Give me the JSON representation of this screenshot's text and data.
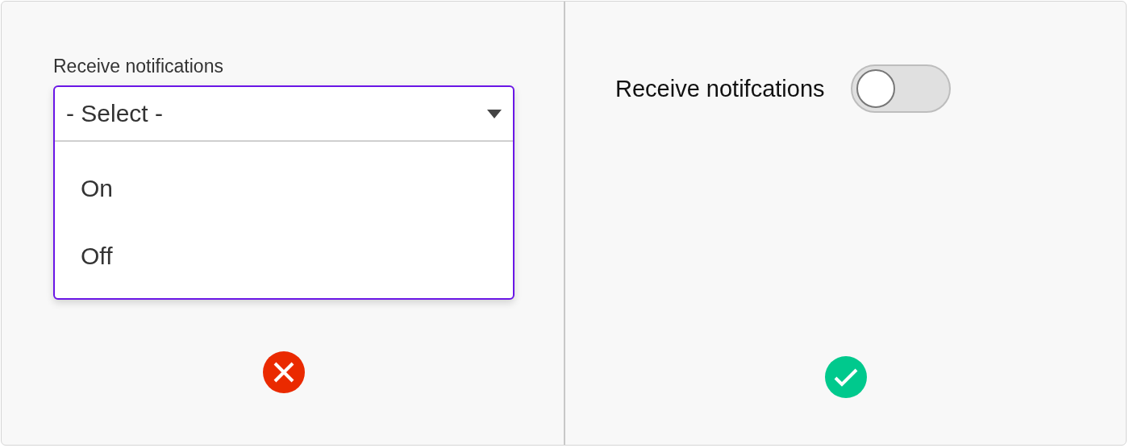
{
  "panels": [
    {
      "kind": "dont",
      "field": {
        "label": "Receive notifications",
        "value": "- Select -",
        "expanded": true,
        "options": [
          "On",
          "Off"
        ]
      }
    },
    {
      "kind": "do",
      "switch": {
        "label": "Receive notifcations",
        "on": false
      }
    }
  ]
}
